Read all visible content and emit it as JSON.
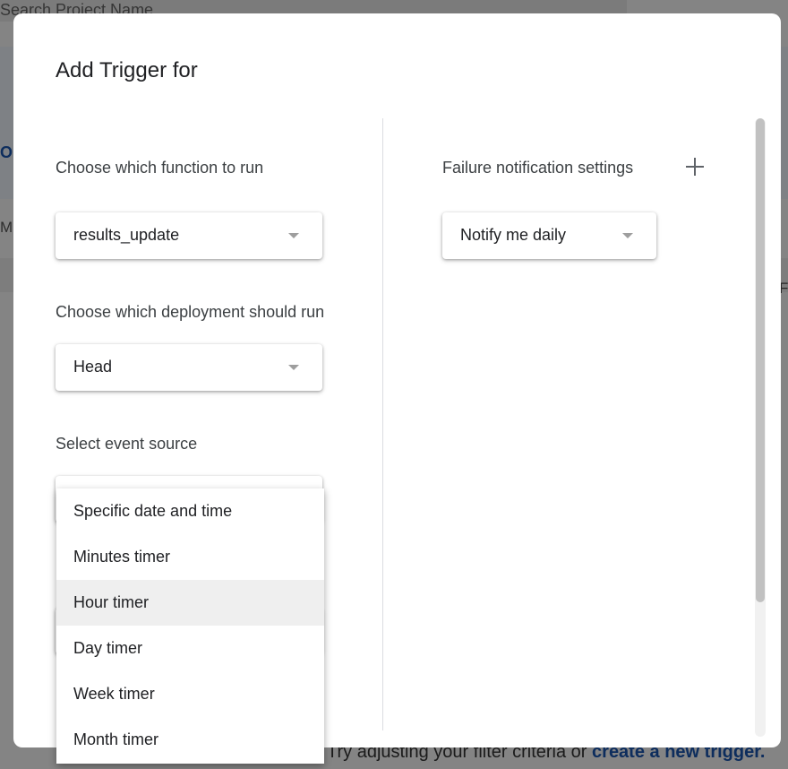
{
  "background": {
    "search_placeholder": "Search Project Name",
    "side_fragment_1": "O",
    "side_fragment_2": "M",
    "right_fragment": "F",
    "empty_text": "Try adjusting your filter criteria or",
    "empty_link": "create a new trigger."
  },
  "dialog": {
    "title": "Add Trigger for",
    "function_label": "Choose which function to run",
    "function_value": "results_update",
    "deployment_label": "Choose which deployment should run",
    "deployment_value": "Head",
    "event_source_label": "Select event source",
    "failure_label": "Failure notification settings",
    "failure_value": "Notify me daily",
    "add_notification_icon": "plus-icon"
  },
  "menu": {
    "items": [
      {
        "label": "Specific date and time"
      },
      {
        "label": "Minutes timer"
      },
      {
        "label": "Hour timer",
        "highlighted": true
      },
      {
        "label": "Day timer"
      },
      {
        "label": "Week timer"
      },
      {
        "label": "Month timer"
      }
    ]
  }
}
